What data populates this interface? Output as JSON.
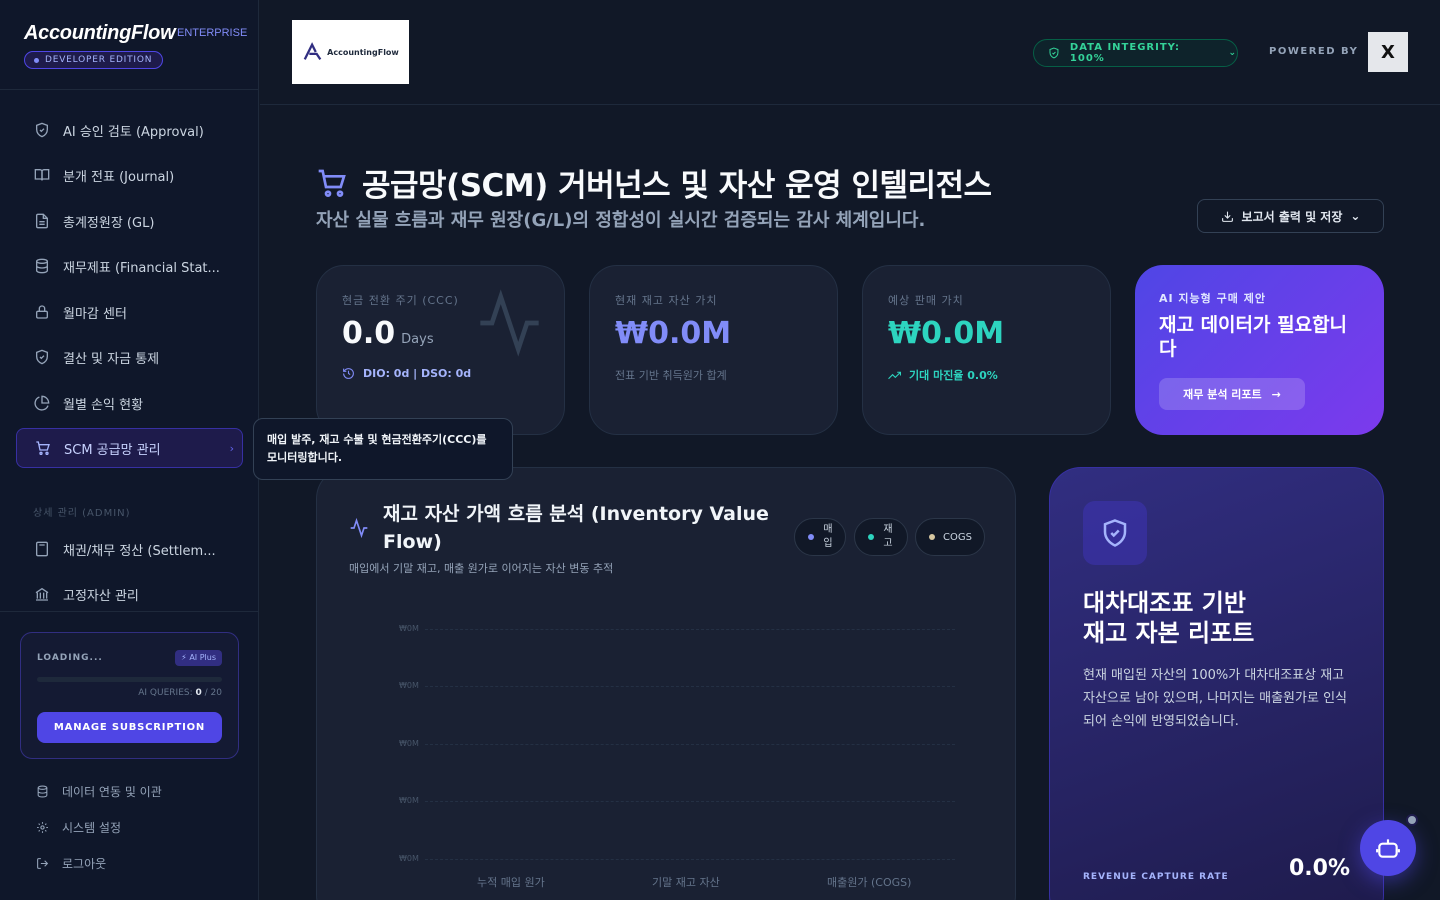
{
  "brand": {
    "name": "AccountingFlow",
    "tag": "ENTERPRISE",
    "edition": "DEVELOPER EDITION"
  },
  "sidebar": {
    "items": [
      {
        "label": "AI 승인 검토 (Approval)",
        "icon": "shield-check-icon"
      },
      {
        "label": "분개 전표 (Journal)",
        "icon": "book-icon"
      },
      {
        "label": "총계정원장 (GL)",
        "icon": "document-icon"
      },
      {
        "label": "재무제표 (Financial Stat...",
        "icon": "database-icon"
      },
      {
        "label": "월마감 센터",
        "icon": "lock-icon"
      },
      {
        "label": "결산 및 자금 통제",
        "icon": "shield-check-icon"
      },
      {
        "label": "월별 손익 현황",
        "icon": "pie-chart-icon"
      },
      {
        "label": "SCM 공급망 관리",
        "icon": "cart-icon",
        "active": true
      }
    ],
    "section_label": "상세 관리 (ADMIN)",
    "admin_items": [
      {
        "label": "채권/채무 정산 (Settlem...",
        "icon": "calculator-icon"
      },
      {
        "label": "고정자산 관리",
        "icon": "bank-icon"
      }
    ],
    "subscription": {
      "loading": "LOADING...",
      "badge": "AI Plus",
      "queries_label": "AI QUERIES:",
      "queries_used": "0",
      "queries_total": "/ 20",
      "usage_fraction": 0,
      "button": "MANAGE SUBSCRIPTION"
    },
    "footer": [
      {
        "label": "데이터 연동 및 이관",
        "icon": "database-icon"
      },
      {
        "label": "시스템 설정",
        "icon": "gear-icon"
      },
      {
        "label": "로그아웃",
        "icon": "logout-icon"
      }
    ]
  },
  "tooltip": {
    "text": "매입 발주, 재고 수불 및 현금전환주기(CCC)를 모니터링합니다."
  },
  "header": {
    "logo_text": "AccountingFlow",
    "integrity": "DATA INTEGRITY: 100%",
    "powered_by": "POWERED BY",
    "x_mark": "X"
  },
  "page": {
    "title": "공급망(SCM) 거버넌스 및 자산 운영 인텔리전스",
    "subtitle": "자산 실물 흐름과 재무 원장(G/L)의 정합성이 실시간 검증되는 감사 체계입니다.",
    "export_label": "보고서 출력 및 저장"
  },
  "kpis": {
    "ccc": {
      "label": "현금 전환 주기 (CCC)",
      "value": "0.0",
      "unit": "Days",
      "note": "DIO: 0d | DSO: 0d"
    },
    "inventory": {
      "label": "현재 재고 자산 가치",
      "value": "₩0.0M",
      "note": "전표 기반 취득원가 합계"
    },
    "sales": {
      "label": "예상 판매 가치",
      "value": "₩0.0M",
      "note": "기대 마진율 0.0%"
    },
    "ai": {
      "label": "AI 지능형 구매 제안",
      "headline": "재고 데이터가 필요합니다",
      "button": "재무 분석 리포트"
    }
  },
  "chart_panel": {
    "title": "재고 자산 가액 흐름 분석 (Inventory Value Flow)",
    "subtitle": "매입에서 기말 재고, 매출 원가로 이어지는 자산 변동 추적",
    "legend": [
      {
        "label": "매입",
        "color": "#818cf8"
      },
      {
        "label": "재고",
        "color": "#2dd4bf"
      },
      {
        "label": "COGS",
        "color": "#d6c7a1"
      }
    ]
  },
  "chart_data": {
    "type": "bar",
    "categories": [
      "누적 매입 원가",
      "기말 재고 자산",
      "매출원가 (COGS)"
    ],
    "values": [
      0,
      0,
      0
    ],
    "yticks": [
      "₩0M",
      "₩0M",
      "₩0M",
      "₩0M",
      "₩0M"
    ],
    "ylabel": "",
    "grid": true
  },
  "balance_panel": {
    "title_line1": "대차대조표 기반",
    "title_line2": "재고 자본 리포트",
    "text": "현재 매입된 자산의 100%가 대차대조표상 재고 자산으로 남아 있으며, 나머지는 매출원가로 인식되어 손익에 반영되었습니다.",
    "rate_label": "REVENUE CAPTURE RATE",
    "rate_value": "0.0%"
  },
  "colors": {
    "accent": "#4f46e5",
    "teal": "#2dd4bf",
    "emerald": "#34d399",
    "bg": "#111827"
  }
}
